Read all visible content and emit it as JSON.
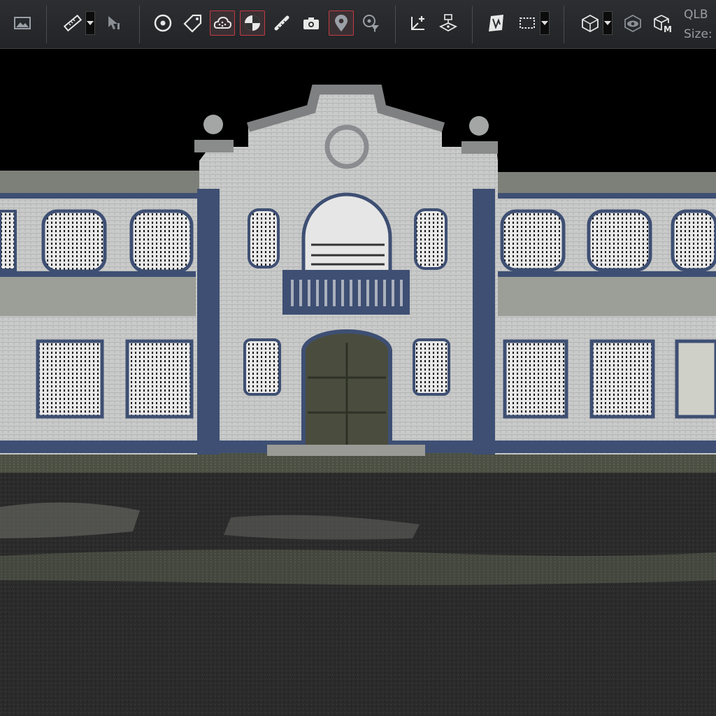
{
  "toolbar": {
    "qlb_label": "QLB",
    "size_label": "Size:",
    "active_color": "#c33a45",
    "tools": [
      {
        "name": "image-icon"
      },
      {
        "name": "ruler-icon"
      },
      {
        "name": "select-pointer-icon"
      },
      {
        "name": "target-icon"
      },
      {
        "name": "tag-icon"
      },
      {
        "name": "cloud-icon",
        "active": true
      },
      {
        "name": "sphere-shading-icon",
        "active": true
      },
      {
        "name": "measure-icon"
      },
      {
        "name": "camera-icon"
      },
      {
        "name": "map-pin-icon",
        "active": true
      },
      {
        "name": "pin-filter-icon"
      },
      {
        "name": "add-point-icon"
      },
      {
        "name": "floor-plane-icon"
      },
      {
        "name": "map-icon"
      },
      {
        "name": "selection-box-icon"
      },
      {
        "name": "cube-icon"
      },
      {
        "name": "eye-cube-icon"
      },
      {
        "name": "model-cube-icon"
      }
    ]
  },
  "viewport": {
    "description_color_sky": "#000000",
    "wall_color": "#c9cac9",
    "trim_color": "#3e4f73",
    "ground_color": "#2a2a2a"
  }
}
